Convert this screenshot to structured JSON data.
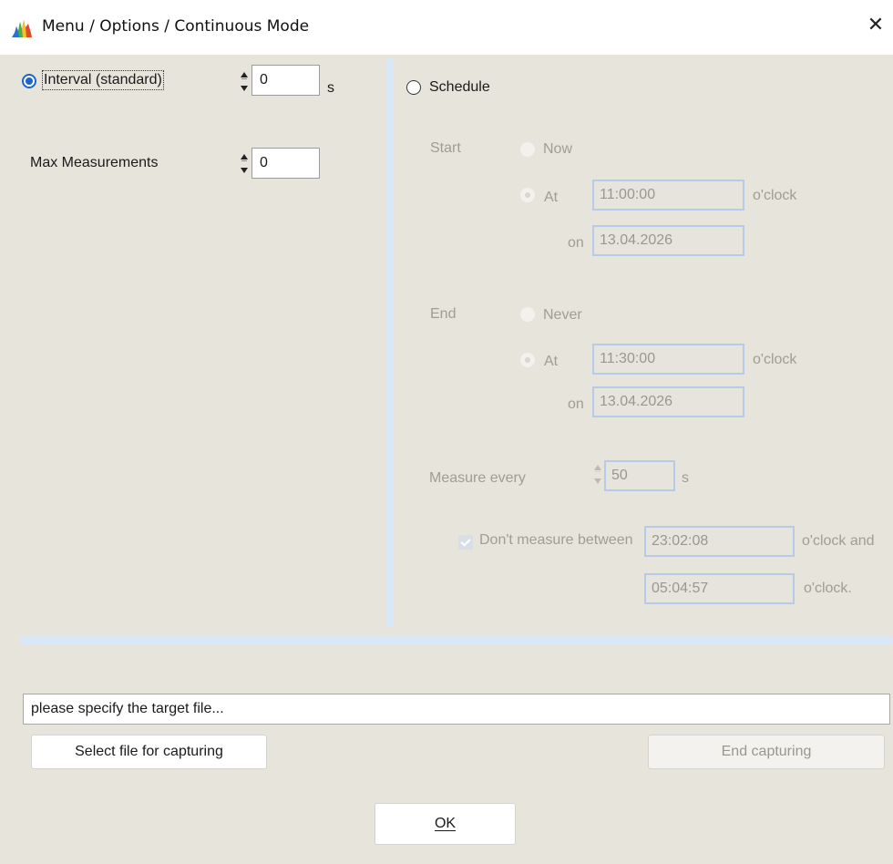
{
  "window": {
    "title": "Menu / Options / Continuous Mode",
    "app_icon": "spectrum-icon",
    "close_glyph": "✕"
  },
  "interval": {
    "label": "Interval (standard)",
    "value": "0",
    "unit": "s",
    "selected": true
  },
  "max_measurements": {
    "label": "Max Measurements",
    "value": "0"
  },
  "schedule": {
    "label": "Schedule",
    "selected": false,
    "start": {
      "label": "Start",
      "now_label": "Now",
      "at_label": "At",
      "time": "11:00:00",
      "oclock": "o'clock",
      "on_label": "on",
      "date": "13.04.2026"
    },
    "end": {
      "label": "End",
      "never_label": "Never",
      "at_label": "At",
      "time": "11:30:00",
      "oclock": "o'clock",
      "on_label": "on",
      "date": "13.04.2026"
    },
    "measure_every": {
      "label": "Measure every",
      "value": "50",
      "unit": "s"
    },
    "dont_measure": {
      "label": "Don't measure between",
      "checked": true,
      "from": "23:02:08",
      "from_suffix": "o'clock and",
      "to": "05:04:57",
      "to_suffix": "o'clock."
    }
  },
  "capture": {
    "target_file": "please specify the target file...",
    "select_button": "Select file for capturing",
    "end_button": "End capturing"
  },
  "ok_button": "OK",
  "colors": {
    "accent": "#1a66c9",
    "background": "#e7e4dc",
    "divider": "#d9e8f6",
    "disabled_text": "#a09d95"
  }
}
